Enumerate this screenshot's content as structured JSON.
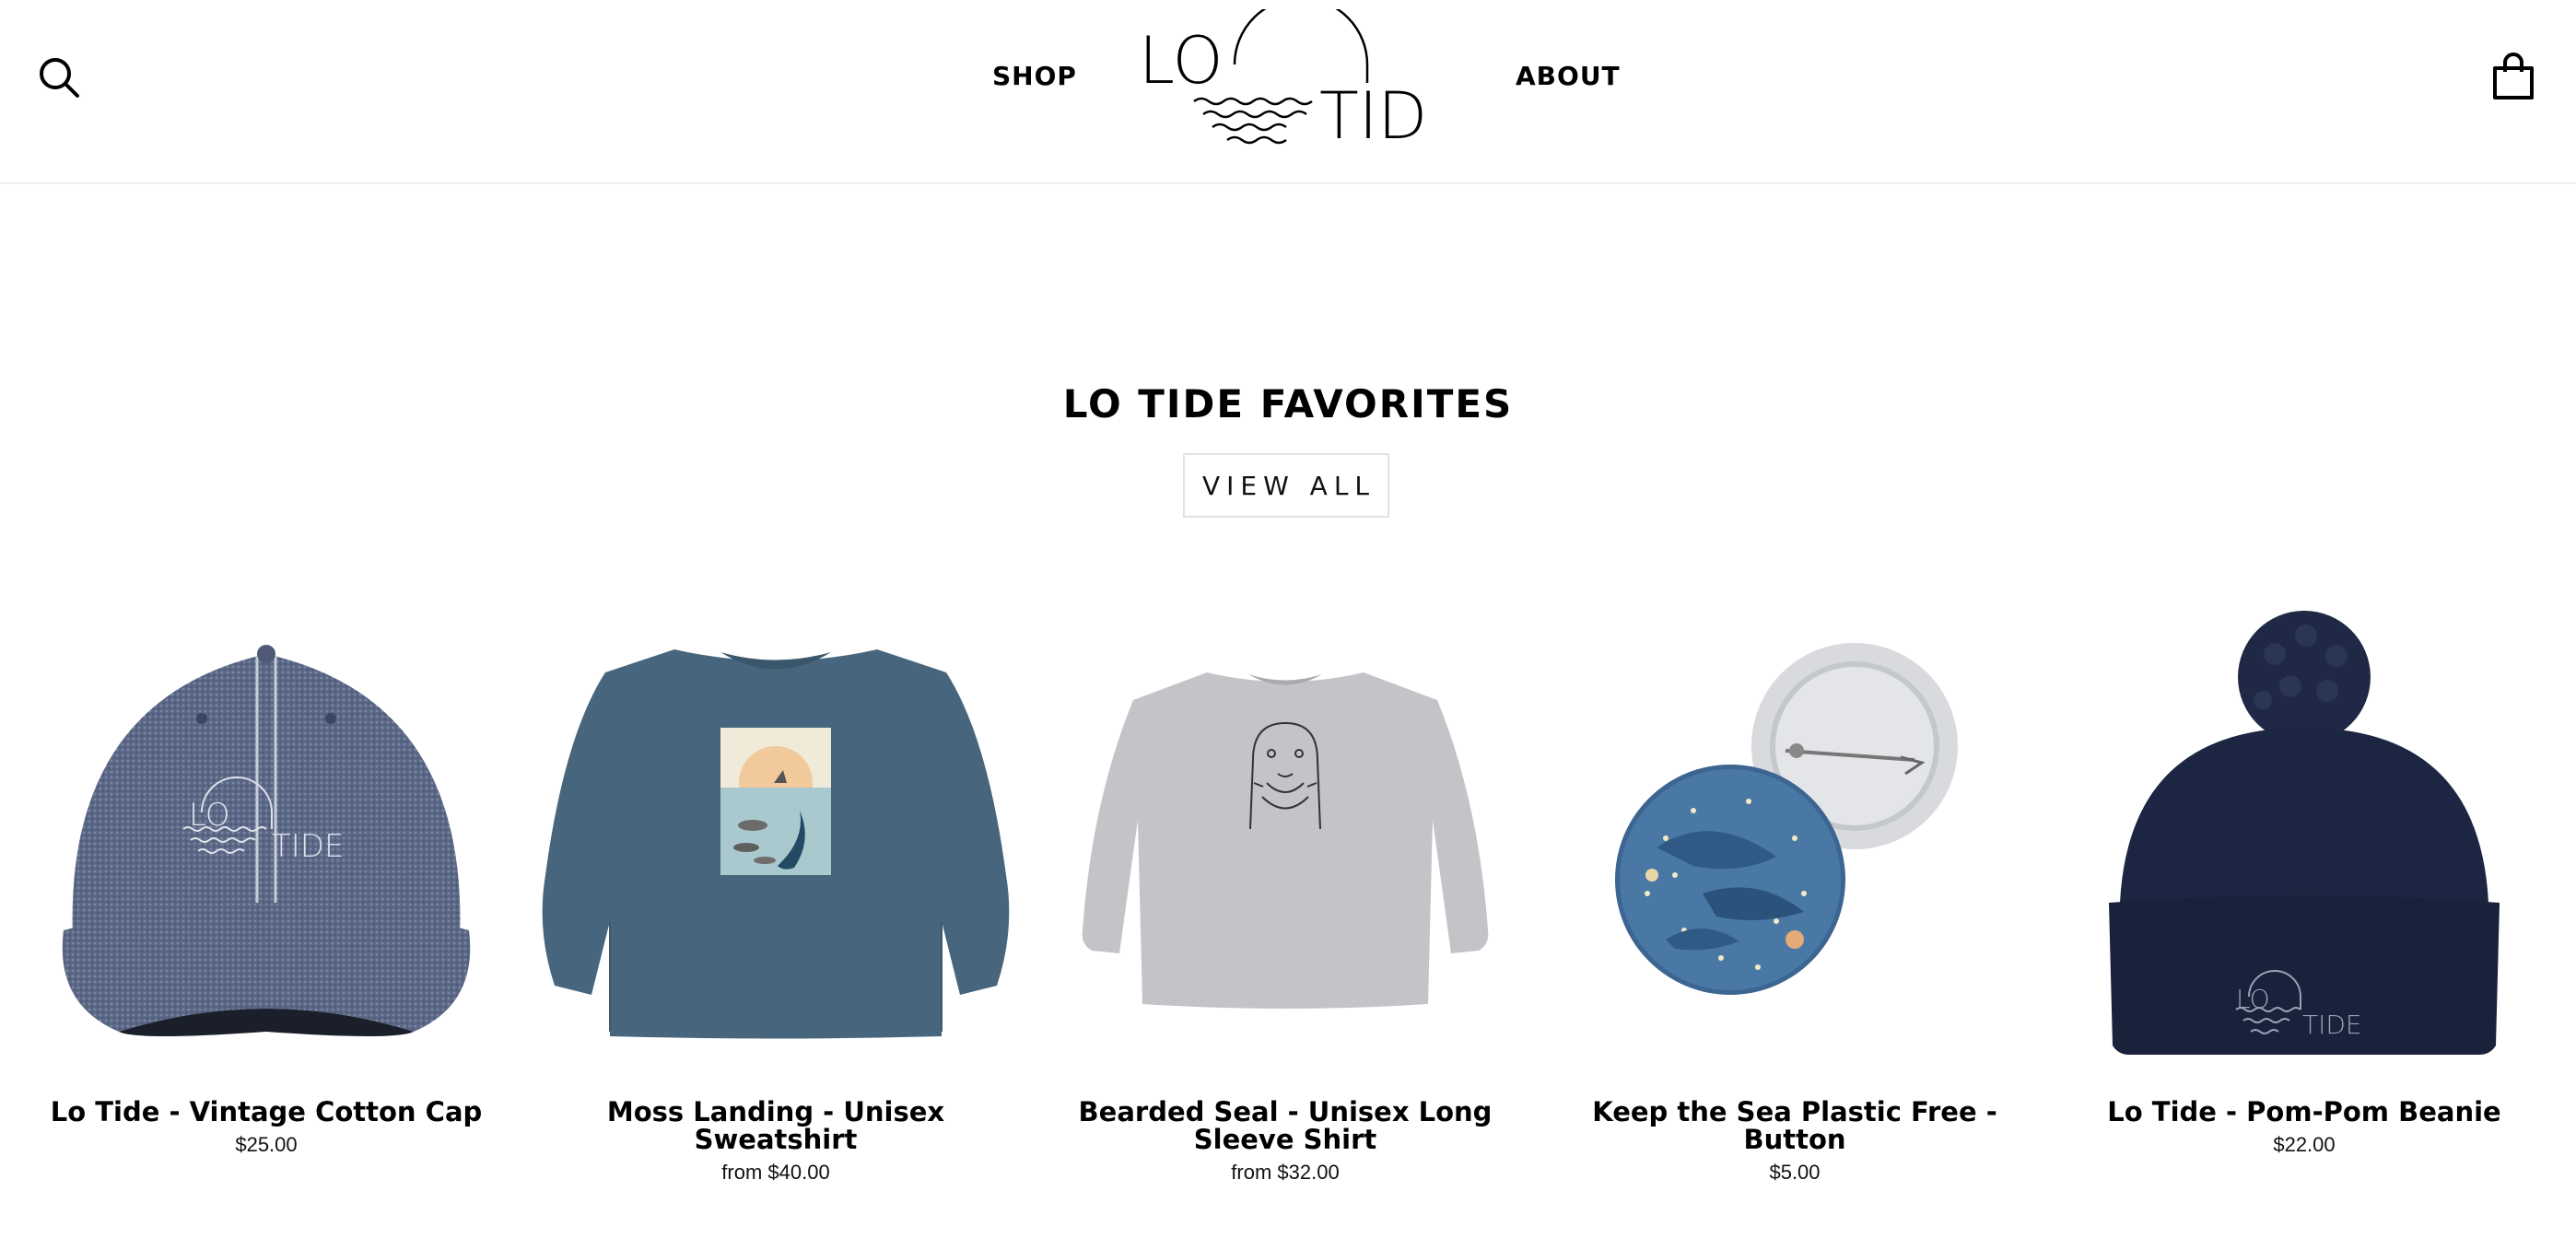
{
  "header": {
    "nav": {
      "shop": "SHOP",
      "about": "ABOUT"
    },
    "logo": {
      "line1": "LO",
      "line2": "TIDE"
    },
    "icons": {
      "search": "search-icon",
      "cart": "shopping-bag-icon"
    }
  },
  "section": {
    "title": "LO TIDE FAVORITES",
    "view_all": "VIEW ALL"
  },
  "products": [
    {
      "name": "Lo Tide - Vintage Cotton Cap",
      "price": "$25.00",
      "image": "cap-image"
    },
    {
      "name": "Moss Landing - Unisex Sweatshirt",
      "price": "from $40.00",
      "image": "sweatshirt-image"
    },
    {
      "name": "Bearded Seal - Unisex Long Sleeve Shirt",
      "price": "from $32.00",
      "image": "long-sleeve-image"
    },
    {
      "name": "Keep the Sea Plastic Free - Button",
      "price": "$5.00",
      "image": "button-pin-image"
    },
    {
      "name": "Lo Tide - Pom-Pom Beanie",
      "price": "$22.00",
      "image": "beanie-image"
    }
  ],
  "colors": {
    "cap": "#5a6785",
    "sweatshirt": "#47667d",
    "long_sleeve": "#c3c4c8",
    "pin": "#4a78a4",
    "beanie": "#1c2541"
  }
}
